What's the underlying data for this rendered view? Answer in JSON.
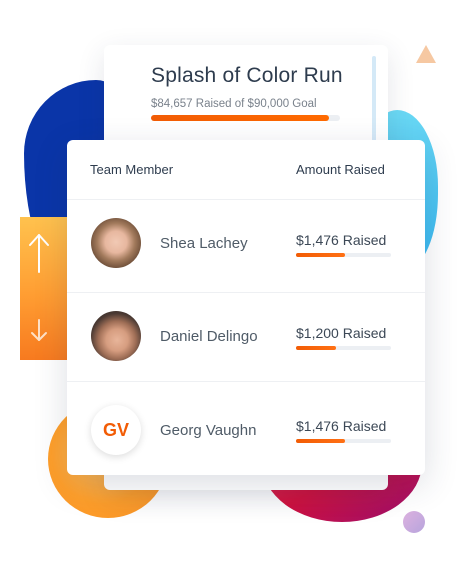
{
  "campaign": {
    "title": "Splash of Color Run",
    "raised_text": "$84,657 Raised of $90,000 Goal",
    "progress": 0.94
  },
  "table": {
    "headers": {
      "member": "Team Member",
      "amount": "Amount Raised"
    },
    "rows": [
      {
        "name": "Shea Lachey",
        "amount_text": "$1,476 Raised",
        "avatar": "photo-woman",
        "progress": 0.52
      },
      {
        "name": "Daniel Delingo",
        "amount_text": "$1,200 Raised",
        "avatar": "photo-man",
        "progress": 0.42
      },
      {
        "name": "Georg Vaughn",
        "amount_text": "$1,476 Raised",
        "avatar_initials": "GV",
        "progress": 0.52
      }
    ]
  },
  "icons": {
    "up": "arrow-up-icon",
    "down": "arrow-down-icon"
  },
  "colors": {
    "accent": "#f25c05",
    "blue_blob": "#0a35a8",
    "magenta_blob": "#d2113e",
    "orange_blob": "#ff9f2a",
    "cyan_blob": "#37b6f0"
  }
}
